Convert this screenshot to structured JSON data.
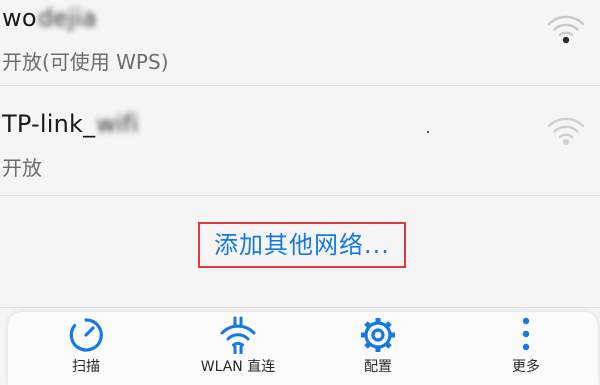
{
  "networks": [
    {
      "ssid_visible": "wo",
      "ssid_blurred": "dejia",
      "status": "开放(可使用 WPS)",
      "signal": "strong-icon"
    },
    {
      "ssid_visible": "TP-link_",
      "ssid_blurred": "wifi",
      "status": "开放",
      "signal": "weak-icon"
    }
  ],
  "add_network": {
    "label": "添加其他网络..."
  },
  "toolbar": {
    "items": [
      {
        "label": "扫描",
        "icon": "refresh-icon"
      },
      {
        "label": "WLAN 直连",
        "icon": "wifi-direct-icon"
      },
      {
        "label": "配置",
        "icon": "gear-icon"
      },
      {
        "label": "更多",
        "icon": "more-vertical-icon"
      }
    ]
  },
  "colors": {
    "accent": "#1479e6",
    "highlight_border": "#e23a3a",
    "text_primary": "#1a1a1a",
    "text_secondary": "#6d6d6d",
    "background": "#f5f5f5"
  }
}
